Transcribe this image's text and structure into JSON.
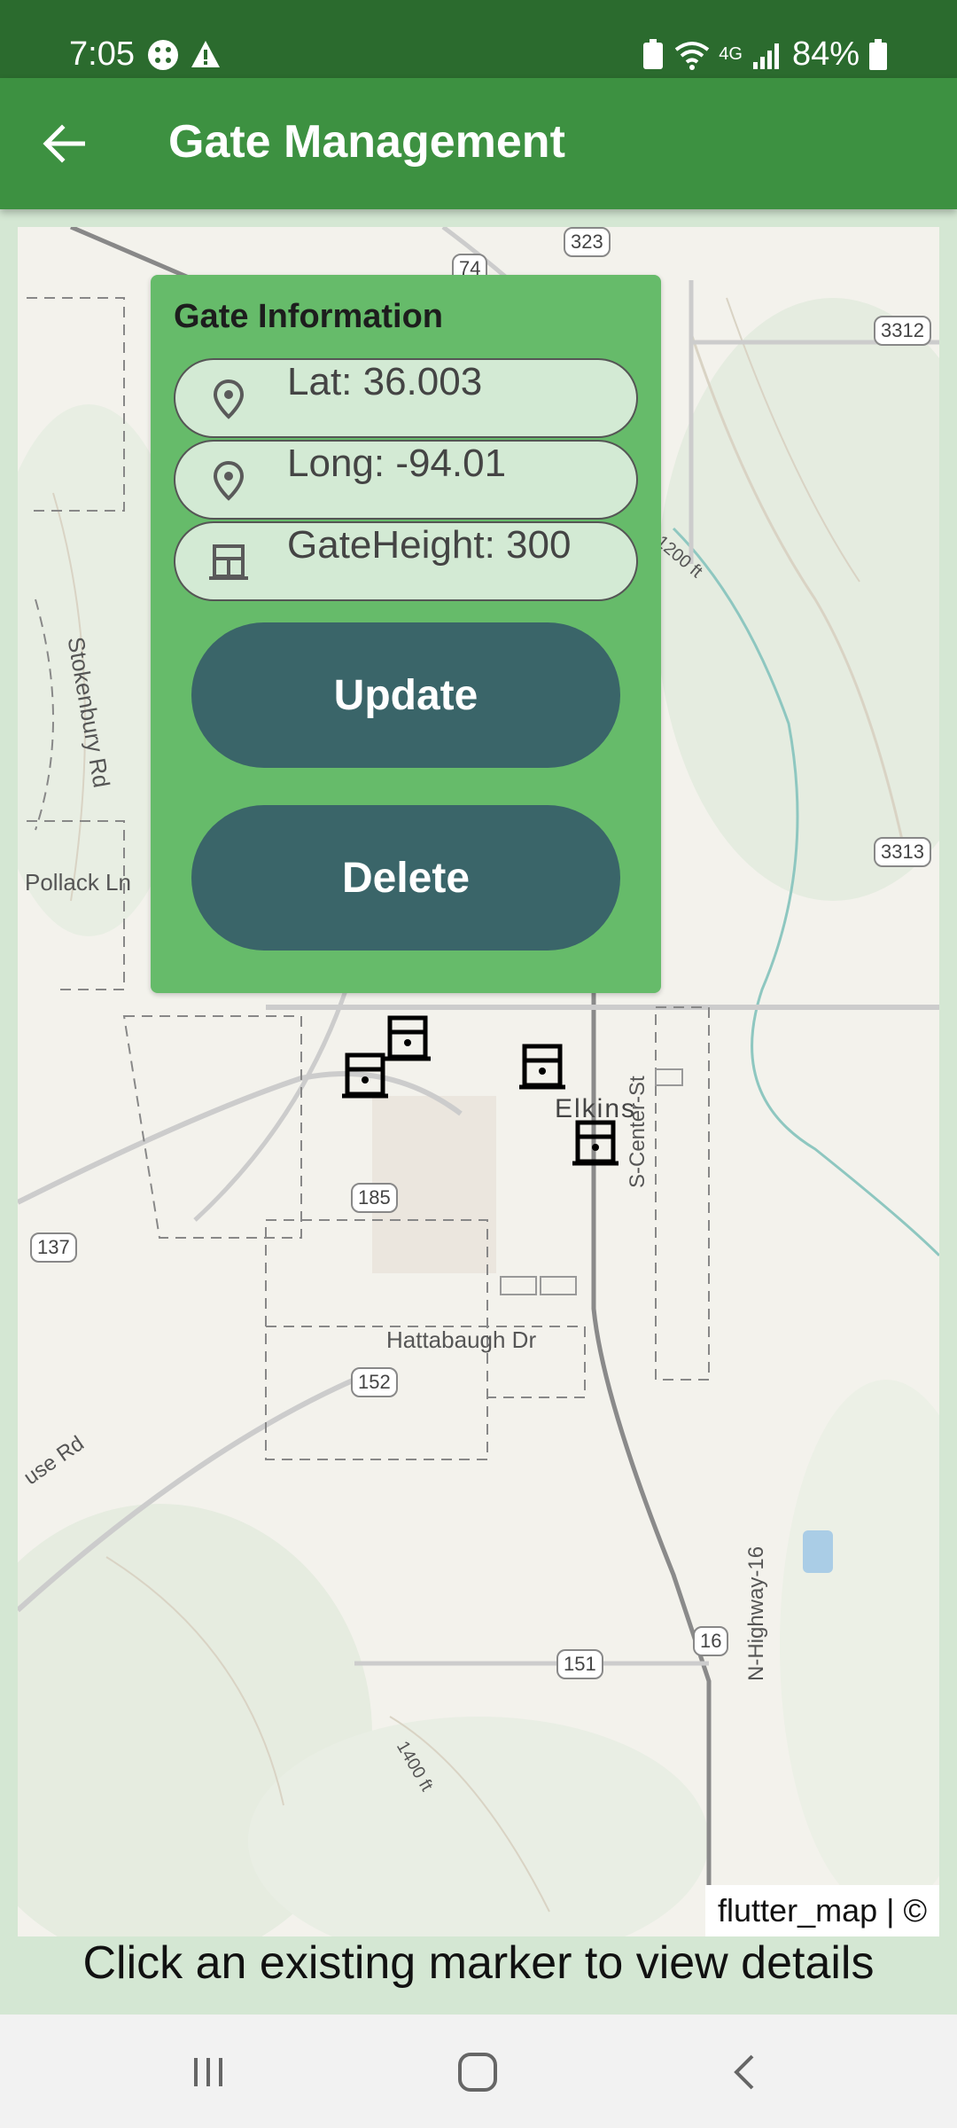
{
  "status_bar": {
    "time": "7:05",
    "battery": "84%",
    "network": "4G"
  },
  "app_bar": {
    "title": "Gate Management"
  },
  "info_panel": {
    "title": "Gate Information",
    "fields": [
      {
        "icon": "location-pin-icon",
        "text": "Lat: 36.003"
      },
      {
        "icon": "location-pin-icon",
        "text": "Long: -94.01"
      },
      {
        "icon": "gate-icon",
        "text": "GateHeight: 300"
      }
    ],
    "update_label": "Update",
    "delete_label": "Delete"
  },
  "map": {
    "labels": {
      "pollack": "Pollack Ln",
      "stokenbury": "Stokenbury Rd",
      "elkins": "Elkins",
      "center_st": "S-Center-St",
      "hattabaugh": "Hattabaugh Dr",
      "highway": "N-Highway-16",
      "house_rd": "use Rd",
      "ft1200": "1200 ft",
      "ft1400": "1400 ft"
    },
    "shields": {
      "s323": "323",
      "s74": "74",
      "s3312": "3312",
      "s3313": "3313",
      "s137": "137",
      "s185": "185",
      "s152": "152",
      "s16": "16",
      "s151": "151"
    },
    "attribution": "flutter_map | ©"
  },
  "hint": "Click an existing marker to view details",
  "colors": {
    "status_bar": "#2b6b2e",
    "app_bar": "#3d9141",
    "panel": "#66bb6a",
    "button": "#3a6569",
    "field": "#d3ead4"
  }
}
